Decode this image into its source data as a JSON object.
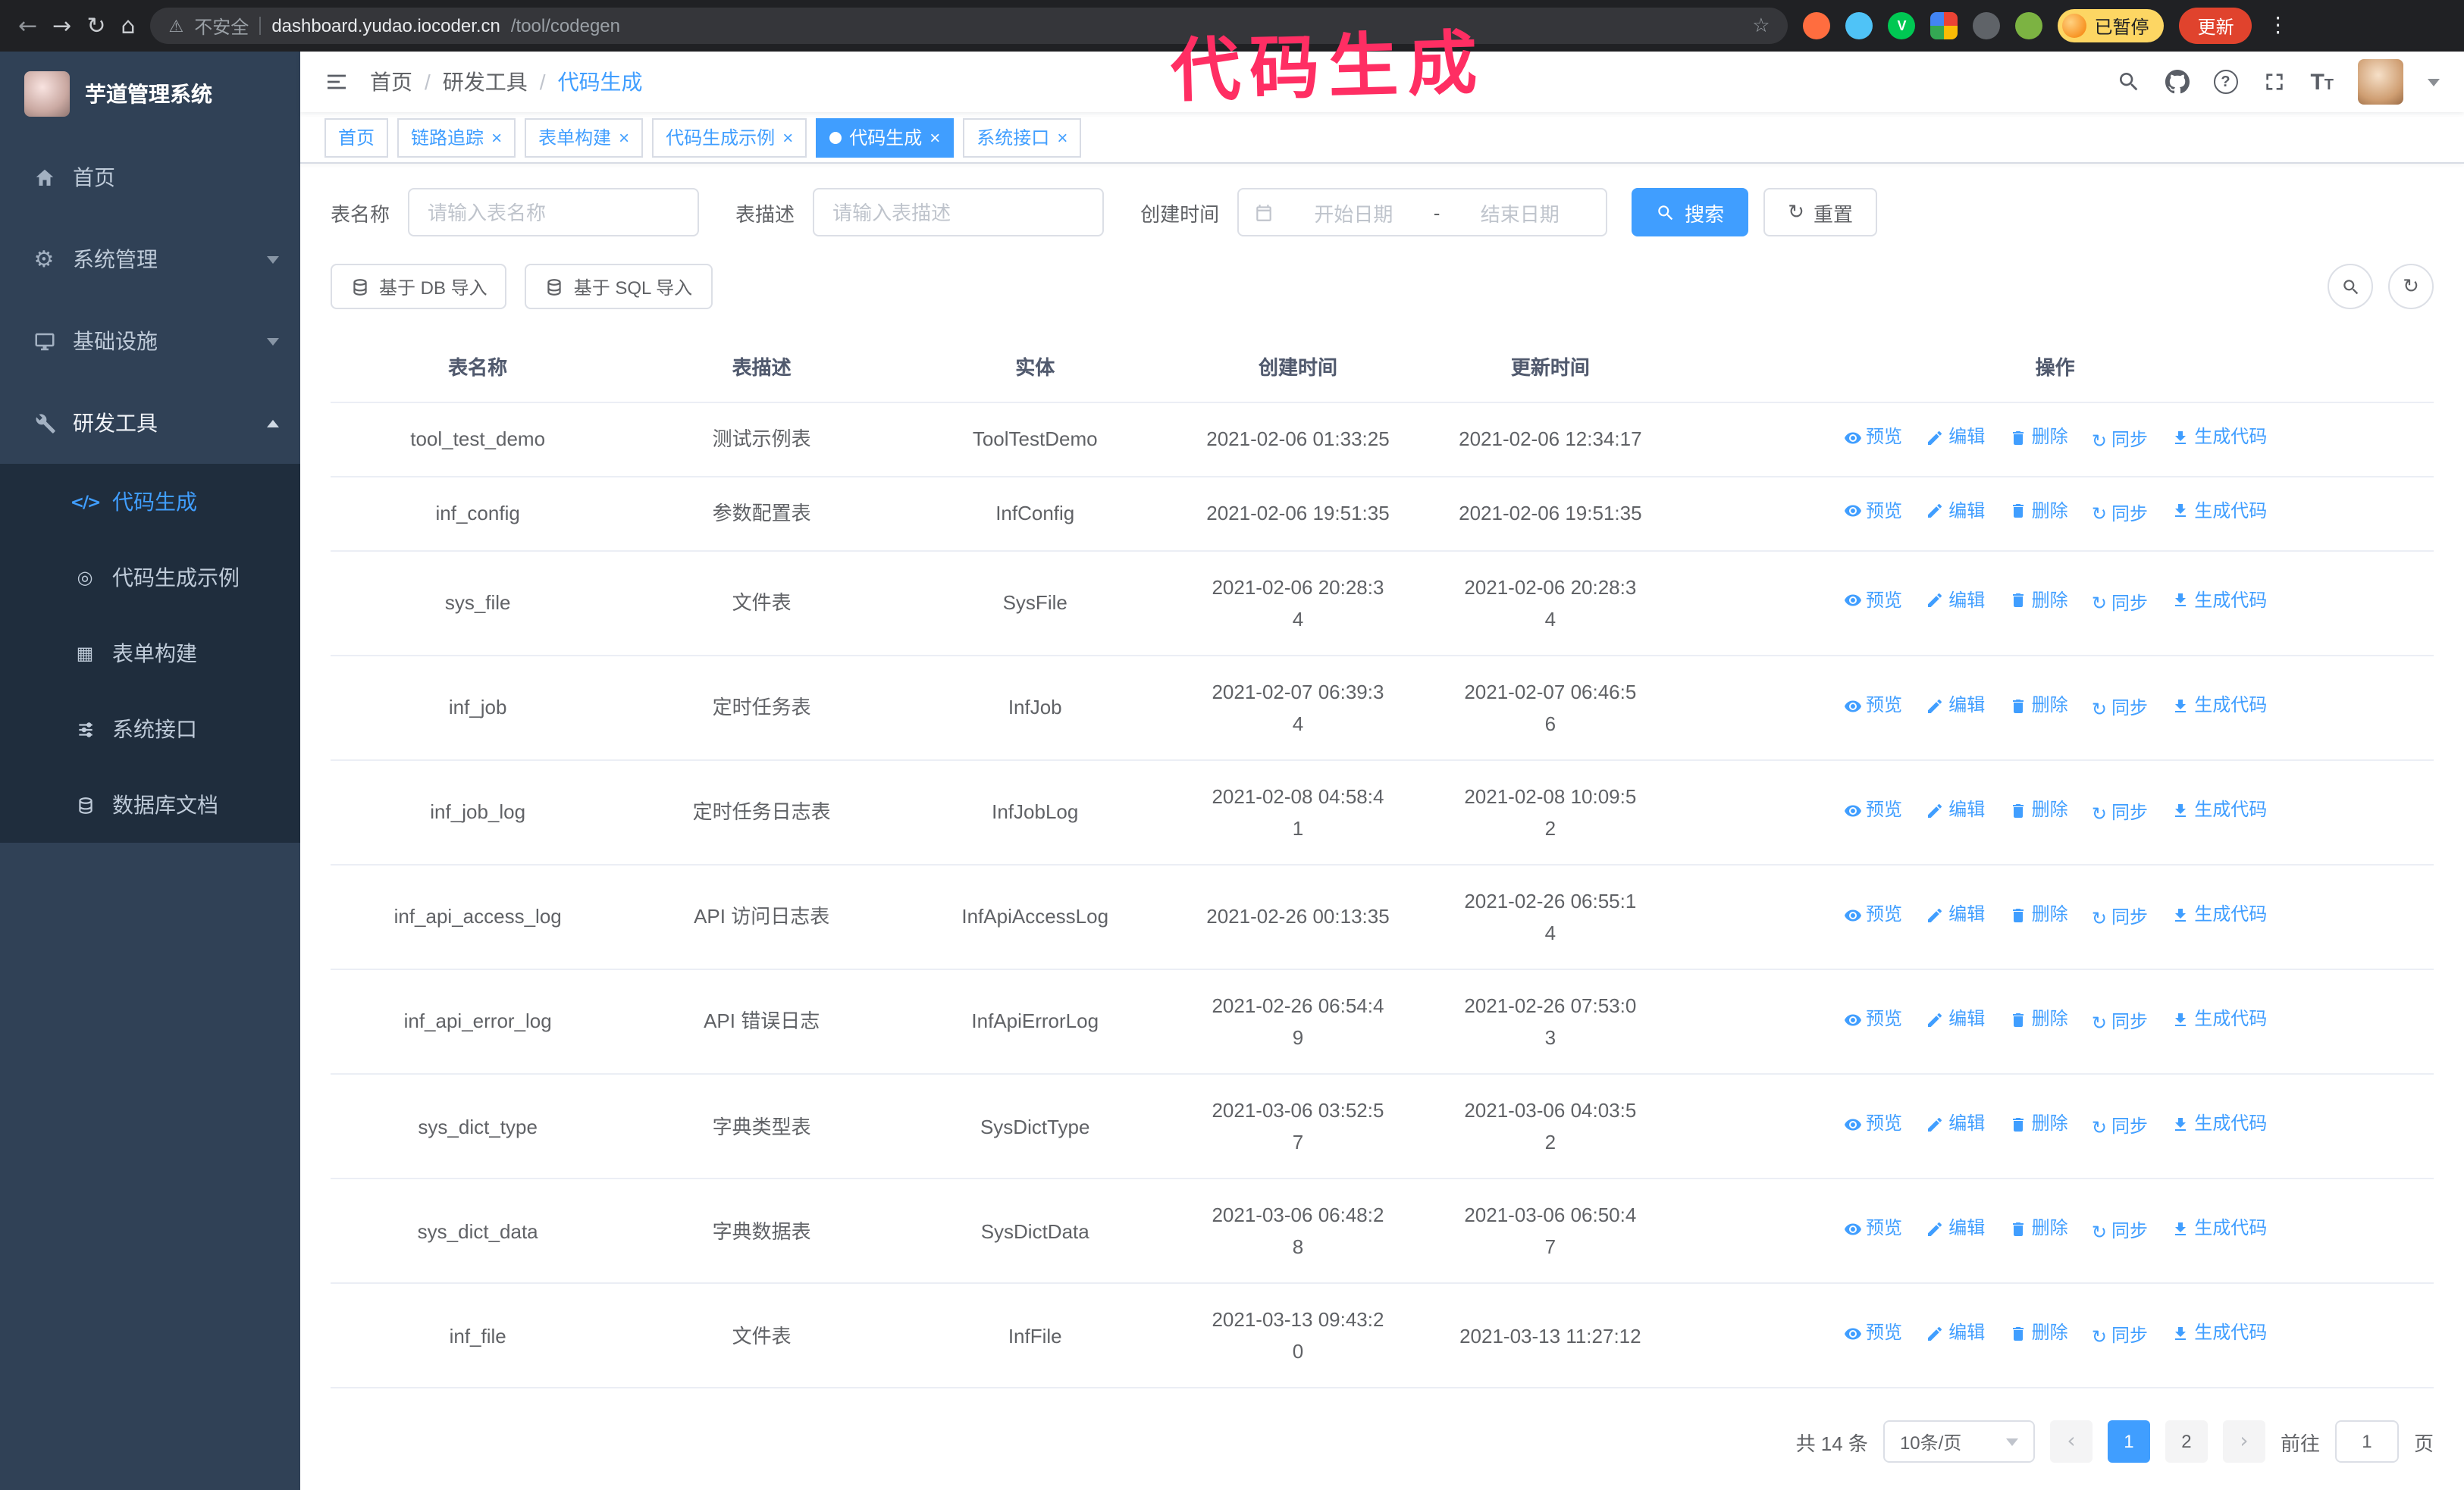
{
  "colors": {
    "accent": "#409eff",
    "annotation": "#ff2e63",
    "sidebar_bg": "#304156",
    "submenu_bg": "#1f2d3d",
    "active_tab_bg": "#409eff",
    "update_button_bg": "#e0432d",
    "paused_badge_bg": "#fdd663"
  },
  "icons": {
    "back": "←",
    "forward": "→",
    "reload": "↻",
    "home": "⌂",
    "warning": "⚠",
    "star": "☆",
    "kebab": "⋮",
    "close": "×",
    "breadcrumb_separator": "/",
    "refresh": "↻",
    "sync": "↻",
    "prev": "‹",
    "next": "›",
    "gear": "⚙",
    "demo": "◎",
    "form": "▦",
    "code": "</>"
  },
  "browser": {
    "security_label": "不安全",
    "url_host": "dashboard.yudao.iocoder.cn",
    "url_path": "/tool/codegen",
    "paused_badge": "已暂停",
    "update_button": "更新"
  },
  "annotation": {
    "text": "代码生成"
  },
  "sidebar": {
    "logo_title": "芋道管理系统",
    "items": [
      {
        "label": "首页"
      },
      {
        "label": "系统管理",
        "expandable": true
      },
      {
        "label": "基础设施",
        "expandable": true
      },
      {
        "label": "研发工具",
        "expandable": true,
        "expanded": true
      }
    ],
    "submenu": [
      {
        "label": "代码生成",
        "active": true
      },
      {
        "label": "代码生成示例"
      },
      {
        "label": "表单构建"
      },
      {
        "label": "系统接口"
      },
      {
        "label": "数据库文档"
      }
    ]
  },
  "header": {
    "breadcrumb": [
      "首页",
      "研发工具",
      "代码生成"
    ]
  },
  "tabs": [
    {
      "label": "首页",
      "closable": false,
      "active": false
    },
    {
      "label": "链路追踪",
      "closable": true,
      "active": false
    },
    {
      "label": "表单构建",
      "closable": true,
      "active": false
    },
    {
      "label": "代码生成示例",
      "closable": true,
      "active": false
    },
    {
      "label": "代码生成",
      "closable": true,
      "active": true
    },
    {
      "label": "系统接口",
      "closable": true,
      "active": false
    }
  ],
  "filters": {
    "table_name_label": "表名称",
    "table_name_placeholder": "请输入表名称",
    "table_desc_label": "表描述",
    "table_desc_placeholder": "请输入表描述",
    "create_time_label": "创建时间",
    "date_start_placeholder": "开始日期",
    "date_separator": "-",
    "date_end_placeholder": "结束日期",
    "search_button": "搜索",
    "reset_button": "重置"
  },
  "toolbar": {
    "import_db": "基于 DB 导入",
    "import_sql": "基于 SQL 导入"
  },
  "table": {
    "columns": [
      "表名称",
      "表描述",
      "实体",
      "创建时间",
      "更新时间",
      "操作"
    ],
    "actions": [
      "预览",
      "编辑",
      "删除",
      "同步",
      "生成代码"
    ],
    "rows": [
      {
        "name": "tool_test_demo",
        "desc": "测试示例表",
        "entity": "ToolTestDemo",
        "created": "2021-02-06 01:33:25",
        "updated": "2021-02-06 12:34:17"
      },
      {
        "name": "inf_config",
        "desc": "参数配置表",
        "entity": "InfConfig",
        "created": "2021-02-06 19:51:35",
        "updated": "2021-02-06 19:51:35"
      },
      {
        "name": "sys_file",
        "desc": "文件表",
        "entity": "SysFile",
        "created": "2021-02-06 20:28:3\n4",
        "updated": "2021-02-06 20:28:3\n4"
      },
      {
        "name": "inf_job",
        "desc": "定时任务表",
        "entity": "InfJob",
        "created": "2021-02-07 06:39:3\n4",
        "updated": "2021-02-07 06:46:5\n6"
      },
      {
        "name": "inf_job_log",
        "desc": "定时任务日志表",
        "entity": "InfJobLog",
        "created": "2021-02-08 04:58:4\n1",
        "updated": "2021-02-08 10:09:5\n2"
      },
      {
        "name": "inf_api_access_log",
        "desc": "API 访问日志表",
        "entity": "InfApiAccessLog",
        "created": "2021-02-26 00:13:35",
        "updated": "2021-02-26 06:55:1\n4"
      },
      {
        "name": "inf_api_error_log",
        "desc": "API 错误日志",
        "entity": "InfApiErrorLog",
        "created": "2021-02-26 06:54:4\n9",
        "updated": "2021-02-26 07:53:0\n3"
      },
      {
        "name": "sys_dict_type",
        "desc": "字典类型表",
        "entity": "SysDictType",
        "created": "2021-03-06 03:52:5\n7",
        "updated": "2021-03-06 04:03:5\n2"
      },
      {
        "name": "sys_dict_data",
        "desc": "字典数据表",
        "entity": "SysDictData",
        "created": "2021-03-06 06:48:2\n8",
        "updated": "2021-03-06 06:50:4\n7"
      },
      {
        "name": "inf_file",
        "desc": "文件表",
        "entity": "InfFile",
        "created": "2021-03-13 09:43:2\n0",
        "updated": "2021-03-13 11:27:12"
      }
    ]
  },
  "pagination": {
    "total_text": "共 14 条",
    "page_size": "10条/页",
    "pages": [
      "1",
      "2"
    ],
    "active_page": "1",
    "goto_label": "前往",
    "goto_value": "1",
    "goto_suffix": "页"
  }
}
